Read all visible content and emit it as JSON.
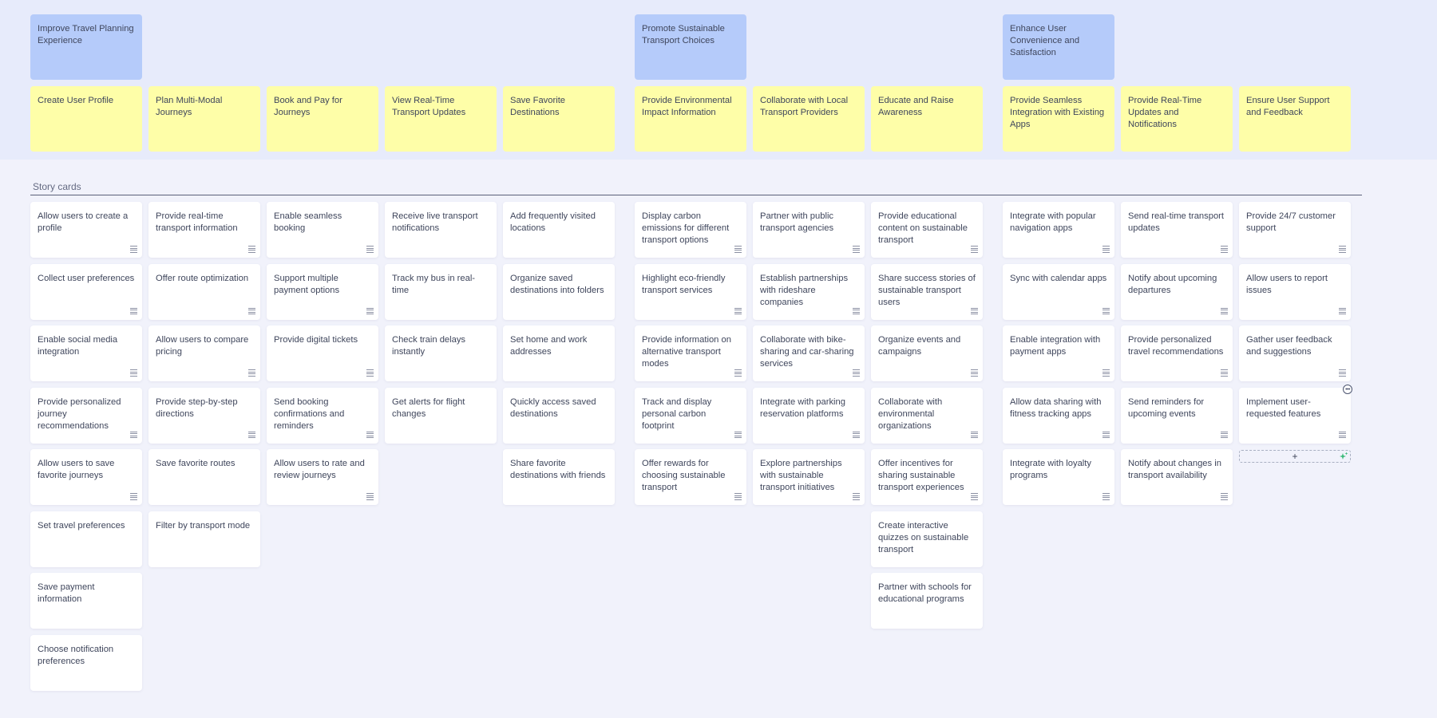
{
  "board": {
    "section_title": "Story cards",
    "add_label": "+",
    "colors": {
      "goal": "#b5cbfa",
      "activity": "#fefea8",
      "story": "#ffffff",
      "ai_accent": "#3dbb7a"
    }
  },
  "goals": [
    {
      "label": "Improve Travel Planning Experience",
      "column": 0
    },
    {
      "label": "Promote Sustainable Transport Choices",
      "column": 5
    },
    {
      "label": "Enhance User Convenience and Satisfaction",
      "column": 8
    }
  ],
  "columns": [
    {
      "activity": "Create User Profile",
      "stories": [
        {
          "text": "Allow users to create a profile",
          "handle": true
        },
        {
          "text": "Collect user preferences",
          "handle": true
        },
        {
          "text": "Enable social media integration",
          "handle": true
        },
        {
          "text": "Provide personalized journey recommendations",
          "handle": true
        },
        {
          "text": "Allow users to save favorite journeys",
          "handle": true
        },
        {
          "text": "Set travel preferences",
          "handle": false
        },
        {
          "text": "Save payment information",
          "handle": false
        },
        {
          "text": "Choose notification preferences",
          "handle": false
        }
      ]
    },
    {
      "activity": "Plan Multi-Modal Journeys",
      "stories": [
        {
          "text": "Provide real-time transport information",
          "handle": true
        },
        {
          "text": "Offer route optimization",
          "handle": true
        },
        {
          "text": "Allow users to compare pricing",
          "handle": true
        },
        {
          "text": "Provide step-by-step directions",
          "handle": true
        },
        {
          "text": "Save favorite routes",
          "handle": false
        },
        {
          "text": "Filter by transport mode",
          "handle": false
        }
      ]
    },
    {
      "activity": "Book and Pay for Journeys",
      "stories": [
        {
          "text": "Enable seamless booking",
          "handle": true
        },
        {
          "text": "Support multiple payment options",
          "handle": true
        },
        {
          "text": "Provide digital tickets",
          "handle": true
        },
        {
          "text": "Send booking confirmations and reminders",
          "handle": true
        },
        {
          "text": "Allow users to rate and review journeys",
          "handle": true
        }
      ]
    },
    {
      "activity": "View Real-Time Transport Updates",
      "stories": [
        {
          "text": "Receive live transport notifications",
          "handle": false
        },
        {
          "text": "Track my bus in real-time",
          "handle": false
        },
        {
          "text": "Check train delays instantly",
          "handle": false
        },
        {
          "text": "Get alerts for flight changes",
          "handle": false
        }
      ]
    },
    {
      "activity": "Save Favorite Destinations",
      "stories": [
        {
          "text": "Add frequently visited locations",
          "handle": false
        },
        {
          "text": "Organize saved destinations into folders",
          "handle": false
        },
        {
          "text": "Set home and work addresses",
          "handle": false
        },
        {
          "text": "Quickly access saved destinations",
          "handle": false
        },
        {
          "text": "Share favorite destinations with friends",
          "handle": false
        }
      ]
    },
    {
      "activity": "Provide Environmental Impact Information",
      "stories": [
        {
          "text": "Display carbon emissions for different transport options",
          "handle": true
        },
        {
          "text": "Highlight eco-friendly transport services",
          "handle": true
        },
        {
          "text": "Provide information on alternative transport modes",
          "handle": true
        },
        {
          "text": "Track and display personal carbon footprint",
          "handle": true
        },
        {
          "text": "Offer rewards for choosing sustainable transport",
          "handle": true
        }
      ]
    },
    {
      "activity": "Collaborate with Local Transport Providers",
      "stories": [
        {
          "text": "Partner with public transport agencies",
          "handle": true
        },
        {
          "text": "Establish partnerships with rideshare companies",
          "handle": true
        },
        {
          "text": "Collaborate with bike-sharing and car-sharing services",
          "handle": true
        },
        {
          "text": "Integrate with parking reservation platforms",
          "handle": true
        },
        {
          "text": "Explore partnerships with sustainable transport initiatives",
          "handle": true
        }
      ]
    },
    {
      "activity": "Educate and Raise Awareness",
      "stories": [
        {
          "text": "Provide educational content on sustainable transport",
          "handle": true
        },
        {
          "text": "Share success stories of sustainable transport users",
          "handle": true
        },
        {
          "text": "Organize events and campaigns",
          "handle": true
        },
        {
          "text": "Collaborate with environmental organizations",
          "handle": true
        },
        {
          "text": "Offer incentives for sharing sustainable transport experiences",
          "handle": true
        },
        {
          "text": "Create interactive quizzes on sustainable transport",
          "handle": false
        },
        {
          "text": "Partner with schools for educational programs",
          "handle": false
        }
      ]
    },
    {
      "activity": "Provide Seamless Integration with Existing Apps",
      "stories": [
        {
          "text": "Integrate with popular navigation apps",
          "handle": true
        },
        {
          "text": "Sync with calendar apps",
          "handle": true
        },
        {
          "text": "Enable integration with payment apps",
          "handle": true
        },
        {
          "text": "Allow data sharing with fitness tracking apps",
          "handle": true
        },
        {
          "text": "Integrate with loyalty programs",
          "handle": true
        }
      ]
    },
    {
      "activity": "Provide Real-Time Updates and Notifications",
      "stories": [
        {
          "text": "Send real-time transport updates",
          "handle": true
        },
        {
          "text": "Notify about upcoming departures",
          "handle": true
        },
        {
          "text": "Provide personalized travel recommendations",
          "handle": true
        },
        {
          "text": "Send reminders for upcoming events",
          "handle": true
        },
        {
          "text": "Notify about changes in transport availability",
          "handle": true
        }
      ]
    },
    {
      "activity": "Ensure User Support and Feedback",
      "stories": [
        {
          "text": "Provide 24/7 customer support",
          "handle": true
        },
        {
          "text": "Allow users to report issues",
          "handle": true
        },
        {
          "text": "Gather user feedback and suggestions",
          "handle": true
        },
        {
          "text": "Implement user-requested features",
          "handle": true
        }
      ]
    }
  ]
}
